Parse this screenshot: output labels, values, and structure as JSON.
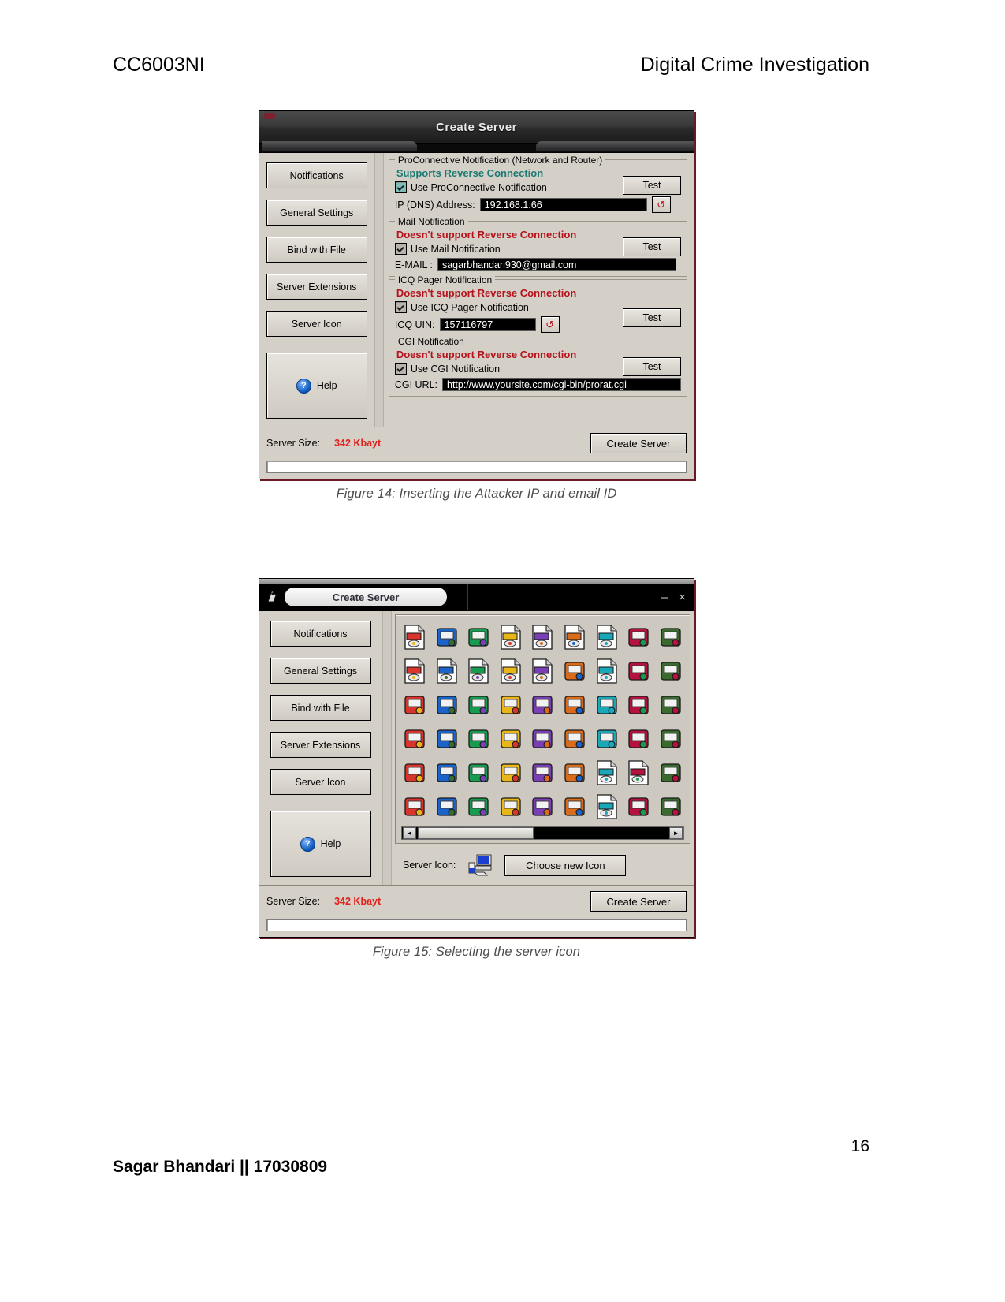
{
  "header": {
    "left": "CC6003NI",
    "right": "Digital Crime Investigation"
  },
  "footer": {
    "author": "Sagar Bhandari || 17030809",
    "page_number": "16"
  },
  "colors": {
    "supports_reverse": "#1b7a72",
    "doesnt_support_reverse": "#b5121b",
    "server_size_value": "#e2211c",
    "window_face": "#d4d0c8",
    "input_background": "#000000"
  },
  "figure14": {
    "caption": "Figure 14: Inserting the Attacker IP and email ID",
    "window_title": "Create Server",
    "sidebar": [
      {
        "label": "Notifications"
      },
      {
        "label": "General Settings"
      },
      {
        "label": "Bind with File"
      },
      {
        "label": "Server Extensions"
      },
      {
        "label": "Server Icon"
      }
    ],
    "help_button": {
      "label": "Help",
      "icon": "help-circle-icon"
    },
    "groups": [
      {
        "title": "ProConnective Notification (Network and Router)",
        "support_text": "Supports Reverse Connection",
        "support_type": "ok",
        "checkbox_label": "Use ProConnective Notification",
        "checkbox_checked": true,
        "field_label": "IP (DNS) Address:",
        "field_value": "192.168.1.66",
        "has_refresh_button": true,
        "test_label": "Test"
      },
      {
        "title": "Mail Notification",
        "support_text": "Doesn't support Reverse Connection",
        "support_type": "no",
        "checkbox_label": "Use Mail Notification",
        "checkbox_checked": true,
        "field_label": "E-MAIL :",
        "field_value": "sagarbhandari930@gmail.com",
        "has_refresh_button": false,
        "test_label": "Test"
      },
      {
        "title": "ICQ Pager Notification",
        "support_text": "Doesn't support Reverse Connection",
        "support_type": "no",
        "checkbox_label": "Use ICQ Pager Notification",
        "checkbox_checked": true,
        "field_label": "ICQ UIN:",
        "field_value": "157116797",
        "has_refresh_button": true,
        "test_label": "Test"
      },
      {
        "title": "CGI Notification",
        "support_text": "Doesn't support Reverse Connection",
        "support_type": "no",
        "checkbox_label": "Use CGI Notification",
        "checkbox_checked": true,
        "field_label": "CGI URL:",
        "field_value": "http://www.yoursite.com/cgi-bin/prorat.cgi",
        "has_refresh_button": false,
        "test_label": "Test"
      }
    ],
    "status": {
      "size_label": "Server Size:",
      "size_value": "342 Kbayt",
      "create_label": "Create Server"
    }
  },
  "figure15": {
    "caption": "Figure 15: Selecting the server icon",
    "window_title": "Create Server",
    "window_buttons": {
      "minimize": "–",
      "close": "×"
    },
    "sidebar": [
      {
        "label": "Notifications"
      },
      {
        "label": "General Settings"
      },
      {
        "label": "Bind with File"
      },
      {
        "label": "Server Extensions"
      },
      {
        "label": "Server Icon"
      }
    ],
    "help_button": {
      "label": "Help",
      "icon": "help-circle-icon"
    },
    "icon_grid": {
      "columns": 9,
      "rows": 6,
      "icons": [
        "pencil-cup-document-icon",
        "image-edit-green-icon",
        "image-edit-red-icon",
        "bmp-preview-icon",
        "jpg-preview-icon",
        "gif-preview-icon",
        "photo-document-icon",
        "pen-holder-icon",
        "paint-palette-icon",
        "search-document-icon",
        "red-lips-document-icon",
        "bomb-document-icon",
        "blank-document-icon",
        "internet-explorer-document-icon",
        "internet-explorer-blue-icon",
        "question-document-icon",
        "internet-explorer-icon",
        "globe-explorer-icon",
        "monitor-setup-icon",
        "notepad-note-icon",
        "red-arrow-app-icon",
        "floppy-save-icon",
        "computer-monitor-icon",
        "shield-key-icon",
        "network-globe-icon",
        "monitor-display-icon",
        "cd-disc-icon",
        "red-lips-icon",
        "yellow-folder-icon",
        "data-chart-icon",
        "key-diamond-icon",
        "white-window-icon",
        "robot-face-icon",
        "red-heart-icon",
        "pink-rose-icon",
        "gift-box-icon",
        "money-bag-icon",
        "mario-character-icon",
        "green-dragon-icon",
        "purple-shield-icon",
        "blue-shield-icon",
        "pda-device-icon",
        "asp-document-icon",
        "cgi-document-icon",
        "firework-icon",
        "hard-disk-icon",
        "camera-icon",
        "cd-rom-disc-icon",
        "mobile-phone-icon",
        "dvd-drive-icon",
        "music-folder-icon",
        "java-document-icon",
        "remote-control-icon",
        "desktop-screen-icon"
      ]
    },
    "scrollbar": {
      "left_arrow": "◄",
      "right_arrow": "►"
    },
    "server_icon_row": {
      "label": "Server Icon:",
      "preview_icon": "computer-network-icon",
      "button_label": "Choose new Icon"
    },
    "status": {
      "size_label": "Server Size:",
      "size_value": "342 Kbayt",
      "create_label": "Create Server"
    }
  }
}
